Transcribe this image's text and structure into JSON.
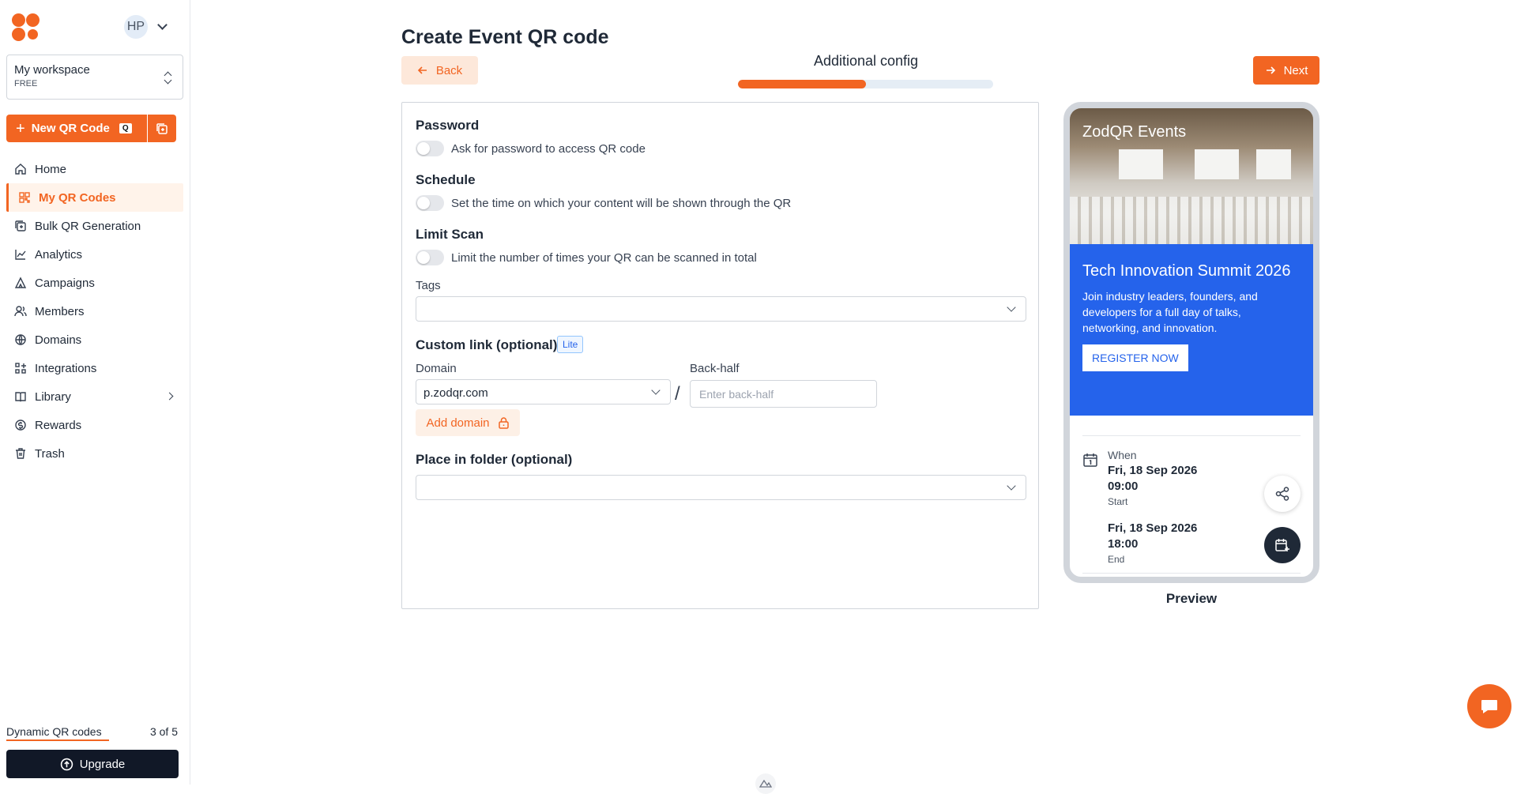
{
  "sidebar": {
    "avatar_initials": "HP",
    "workspace": {
      "name": "My workspace",
      "plan": "FREE"
    },
    "new_qr": {
      "label": "New QR Code",
      "shortcut": "Q"
    },
    "items": [
      {
        "label": "Home",
        "icon": "home-icon"
      },
      {
        "label": "My QR Codes",
        "icon": "qr-grid-icon",
        "active": true
      },
      {
        "label": "Bulk QR Generation",
        "icon": "bulk-icon"
      },
      {
        "label": "Analytics",
        "icon": "analytics-icon"
      },
      {
        "label": "Campaigns",
        "icon": "campaign-icon"
      },
      {
        "label": "Members",
        "icon": "members-icon"
      },
      {
        "label": "Domains",
        "icon": "globe-icon"
      },
      {
        "label": "Integrations",
        "icon": "integrations-icon"
      },
      {
        "label": "Library",
        "icon": "library-icon",
        "has_submenu": true
      },
      {
        "label": "Rewards",
        "icon": "rewards-icon"
      },
      {
        "label": "Trash",
        "icon": "trash-icon"
      }
    ],
    "quota": {
      "label": "Dynamic QR codes",
      "value": "3 of 5",
      "used_fraction": 0.6
    },
    "upgrade_label": "Upgrade"
  },
  "header": {
    "title": "Create Event QR code",
    "back_label": "Back",
    "next_label": "Next",
    "step_label": "Additional config",
    "step_progress": 0.5
  },
  "form": {
    "password": {
      "title": "Password",
      "toggle_label": "Ask for password to access QR code",
      "enabled": false
    },
    "schedule": {
      "title": "Schedule",
      "toggle_label": "Set the time on which your content will be shown through the QR",
      "enabled": false
    },
    "limit_scan": {
      "title": "Limit Scan",
      "toggle_label": "Limit the number of times your QR can be scanned in total",
      "enabled": false
    },
    "tags": {
      "label": "Tags",
      "value": ""
    },
    "custom_link": {
      "title": "Custom link (optional)",
      "badge": "Lite",
      "domain_label": "Domain",
      "domain_value": "p.zodqr.com",
      "separator": "/",
      "backhalf_label": "Back-half",
      "backhalf_placeholder": "Enter back-half",
      "add_domain_label": "Add domain"
    },
    "folder": {
      "title": "Place in folder (optional)",
      "value": ""
    }
  },
  "preview": {
    "brand": "ZodQR Events",
    "event_title": "Tech Innovation Summit 2026",
    "event_description": "Join industry leaders, founders, and developers for a full day of talks, networking, and innovation.",
    "register_label": "REGISTER NOW",
    "when_label": "When",
    "start_datetime": "Fri, 18 Sep 2026 09:00",
    "start_label": "Start",
    "end_datetime": "Fri, 18 Sep 2026 18:00",
    "end_label": "End",
    "label": "Preview"
  },
  "colors": {
    "accent": "#f26522",
    "event_blue": "#2563eb",
    "dark": "#111827"
  }
}
